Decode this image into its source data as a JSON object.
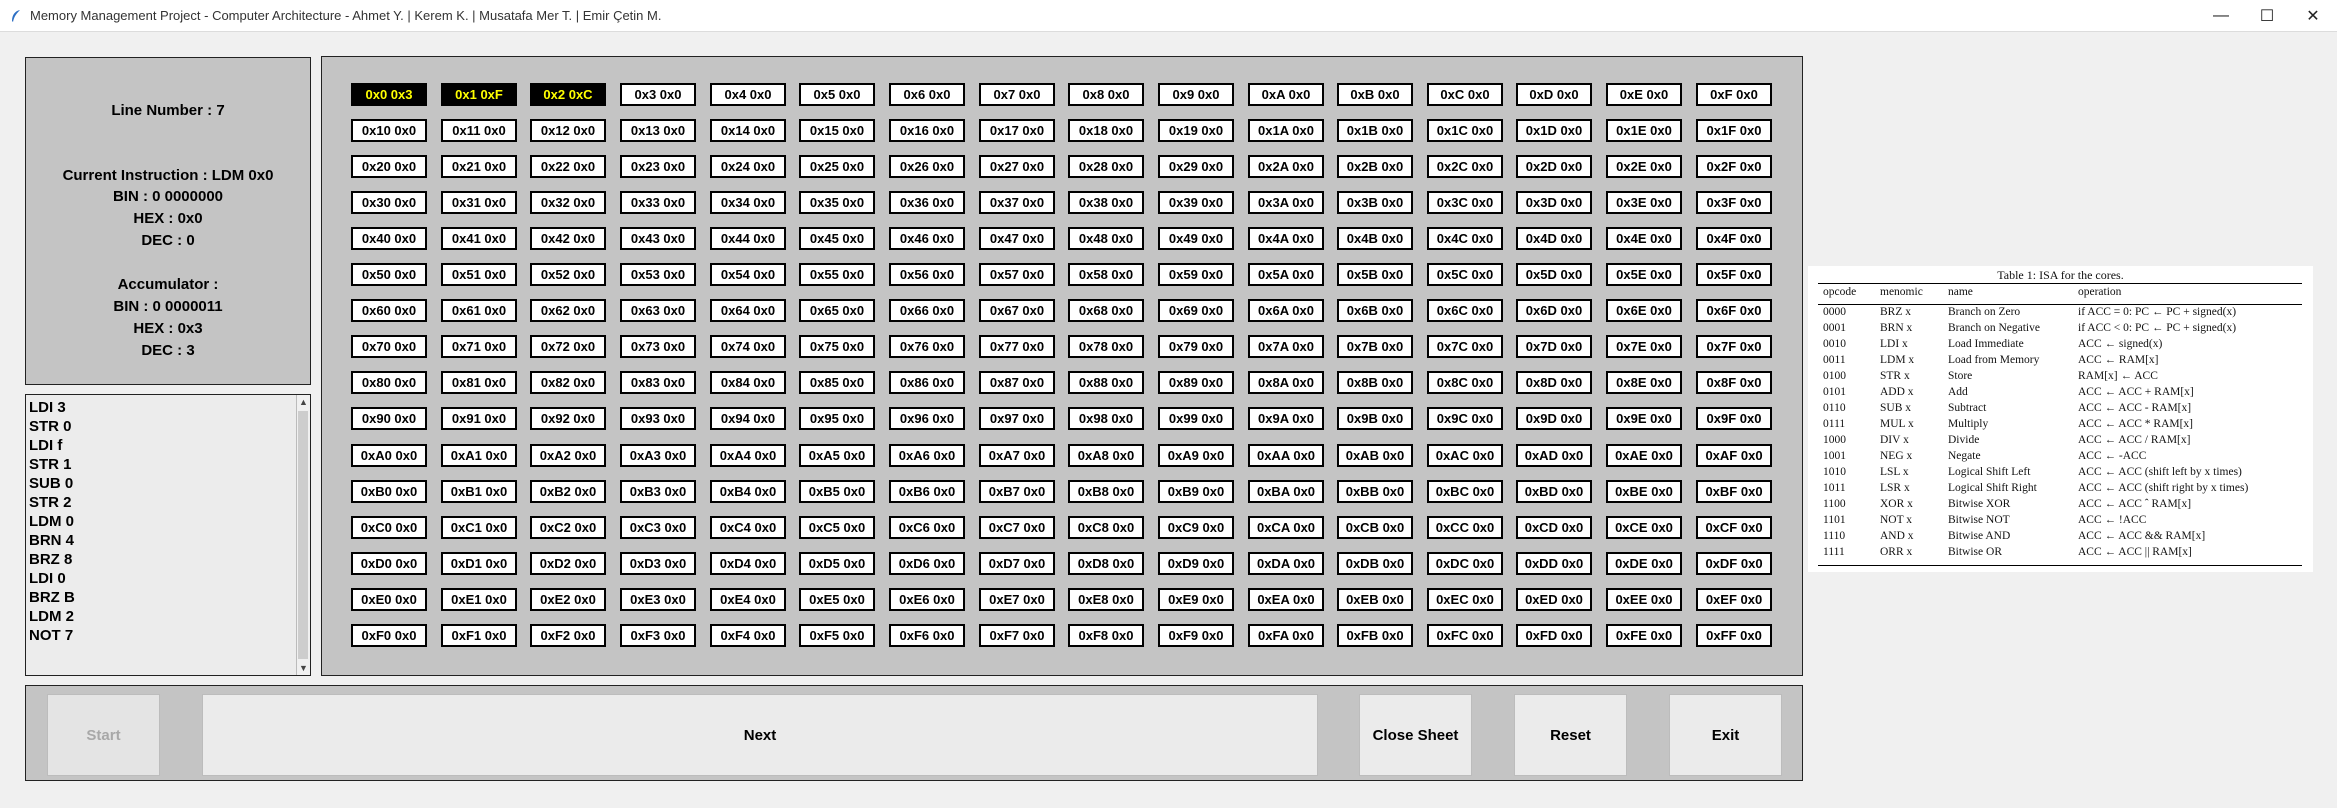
{
  "window": {
    "title": "Memory Management Project - Computer Architecture - Ahmet Y. | Kerem K. | Musatafa Mer T. | Emir Çetin M.",
    "minimize_glyph": "—",
    "maximize_glyph": "☐",
    "close_glyph": "✕"
  },
  "info": {
    "line_number": "Line Number  :  7",
    "current_instruction": "Current Instruction  : LDM 0x0",
    "instr_bin": "BIN  :  0 0000000",
    "instr_hex": "HEX  :   0x0",
    "instr_dec": "DEC  :   0",
    "accumulator": "Accumulator  :",
    "acc_bin": "BIN  :  0 0000011",
    "acc_hex": "HEX  :   0x3",
    "acc_dec": "DEC  :   3"
  },
  "code": [
    "LDI 3",
    "STR 0",
    "LDI f",
    "STR 1",
    "SUB 0",
    "STR 2",
    "LDM 0",
    "BRN 4",
    "BRZ 8",
    "LDI 0",
    "BRZ B",
    "LDM 2",
    "NOT 7"
  ],
  "memory": {
    "highlight_color": "#ffff00",
    "cells": [
      [
        "0x0 0x3",
        "0x1 0xF",
        "0x2 0xC",
        "0x3 0x0",
        "0x4 0x0",
        "0x5 0x0",
        "0x6 0x0",
        "0x7 0x0",
        "0x8 0x0",
        "0x9 0x0",
        "0xA 0x0",
        "0xB 0x0",
        "0xC 0x0",
        "0xD 0x0",
        "0xE 0x0",
        "0xF 0x0"
      ],
      [
        "0x10 0x0",
        "0x11 0x0",
        "0x12 0x0",
        "0x13 0x0",
        "0x14 0x0",
        "0x15 0x0",
        "0x16 0x0",
        "0x17 0x0",
        "0x18 0x0",
        "0x19 0x0",
        "0x1A 0x0",
        "0x1B 0x0",
        "0x1C 0x0",
        "0x1D 0x0",
        "0x1E 0x0",
        "0x1F 0x0"
      ],
      [
        "0x20 0x0",
        "0x21 0x0",
        "0x22 0x0",
        "0x23 0x0",
        "0x24 0x0",
        "0x25 0x0",
        "0x26 0x0",
        "0x27 0x0",
        "0x28 0x0",
        "0x29 0x0",
        "0x2A 0x0",
        "0x2B 0x0",
        "0x2C 0x0",
        "0x2D 0x0",
        "0x2E 0x0",
        "0x2F 0x0"
      ],
      [
        "0x30 0x0",
        "0x31 0x0",
        "0x32 0x0",
        "0x33 0x0",
        "0x34 0x0",
        "0x35 0x0",
        "0x36 0x0",
        "0x37 0x0",
        "0x38 0x0",
        "0x39 0x0",
        "0x3A 0x0",
        "0x3B 0x0",
        "0x3C 0x0",
        "0x3D 0x0",
        "0x3E 0x0",
        "0x3F 0x0"
      ],
      [
        "0x40 0x0",
        "0x41 0x0",
        "0x42 0x0",
        "0x43 0x0",
        "0x44 0x0",
        "0x45 0x0",
        "0x46 0x0",
        "0x47 0x0",
        "0x48 0x0",
        "0x49 0x0",
        "0x4A 0x0",
        "0x4B 0x0",
        "0x4C 0x0",
        "0x4D 0x0",
        "0x4E 0x0",
        "0x4F 0x0"
      ],
      [
        "0x50 0x0",
        "0x51 0x0",
        "0x52 0x0",
        "0x53 0x0",
        "0x54 0x0",
        "0x55 0x0",
        "0x56 0x0",
        "0x57 0x0",
        "0x58 0x0",
        "0x59 0x0",
        "0x5A 0x0",
        "0x5B 0x0",
        "0x5C 0x0",
        "0x5D 0x0",
        "0x5E 0x0",
        "0x5F 0x0"
      ],
      [
        "0x60 0x0",
        "0x61 0x0",
        "0x62 0x0",
        "0x63 0x0",
        "0x64 0x0",
        "0x65 0x0",
        "0x66 0x0",
        "0x67 0x0",
        "0x68 0x0",
        "0x69 0x0",
        "0x6A 0x0",
        "0x6B 0x0",
        "0x6C 0x0",
        "0x6D 0x0",
        "0x6E 0x0",
        "0x6F 0x0"
      ],
      [
        "0x70 0x0",
        "0x71 0x0",
        "0x72 0x0",
        "0x73 0x0",
        "0x74 0x0",
        "0x75 0x0",
        "0x76 0x0",
        "0x77 0x0",
        "0x78 0x0",
        "0x79 0x0",
        "0x7A 0x0",
        "0x7B 0x0",
        "0x7C 0x0",
        "0x7D 0x0",
        "0x7E 0x0",
        "0x7F 0x0"
      ],
      [
        "0x80 0x0",
        "0x81 0x0",
        "0x82 0x0",
        "0x83 0x0",
        "0x84 0x0",
        "0x85 0x0",
        "0x86 0x0",
        "0x87 0x0",
        "0x88 0x0",
        "0x89 0x0",
        "0x8A 0x0",
        "0x8B 0x0",
        "0x8C 0x0",
        "0x8D 0x0",
        "0x8E 0x0",
        "0x8F 0x0"
      ],
      [
        "0x90 0x0",
        "0x91 0x0",
        "0x92 0x0",
        "0x93 0x0",
        "0x94 0x0",
        "0x95 0x0",
        "0x96 0x0",
        "0x97 0x0",
        "0x98 0x0",
        "0x99 0x0",
        "0x9A 0x0",
        "0x9B 0x0",
        "0x9C 0x0",
        "0x9D 0x0",
        "0x9E 0x0",
        "0x9F 0x0"
      ],
      [
        "0xA0 0x0",
        "0xA1 0x0",
        "0xA2 0x0",
        "0xA3 0x0",
        "0xA4 0x0",
        "0xA5 0x0",
        "0xA6 0x0",
        "0xA7 0x0",
        "0xA8 0x0",
        "0xA9 0x0",
        "0xAA 0x0",
        "0xAB 0x0",
        "0xAC 0x0",
        "0xAD 0x0",
        "0xAE 0x0",
        "0xAF 0x0"
      ],
      [
        "0xB0 0x0",
        "0xB1 0x0",
        "0xB2 0x0",
        "0xB3 0x0",
        "0xB4 0x0",
        "0xB5 0x0",
        "0xB6 0x0",
        "0xB7 0x0",
        "0xB8 0x0",
        "0xB9 0x0",
        "0xBA 0x0",
        "0xBB 0x0",
        "0xBC 0x0",
        "0xBD 0x0",
        "0xBE 0x0",
        "0xBF 0x0"
      ],
      [
        "0xC0 0x0",
        "0xC1 0x0",
        "0xC2 0x0",
        "0xC3 0x0",
        "0xC4 0x0",
        "0xC5 0x0",
        "0xC6 0x0",
        "0xC7 0x0",
        "0xC8 0x0",
        "0xC9 0x0",
        "0xCA 0x0",
        "0xCB 0x0",
        "0xCC 0x0",
        "0xCD 0x0",
        "0xCE 0x0",
        "0xCF 0x0"
      ],
      [
        "0xD0 0x0",
        "0xD1 0x0",
        "0xD2 0x0",
        "0xD3 0x0",
        "0xD4 0x0",
        "0xD5 0x0",
        "0xD6 0x0",
        "0xD7 0x0",
        "0xD8 0x0",
        "0xD9 0x0",
        "0xDA 0x0",
        "0xDB 0x0",
        "0xDC 0x0",
        "0xDD 0x0",
        "0xDE 0x0",
        "0xDF 0x0"
      ],
      [
        "0xE0 0x0",
        "0xE1 0x0",
        "0xE2 0x0",
        "0xE3 0x0",
        "0xE4 0x0",
        "0xE5 0x0",
        "0xE6 0x0",
        "0xE7 0x0",
        "0xE8 0x0",
        "0xE9 0x0",
        "0xEA 0x0",
        "0xEB 0x0",
        "0xEC 0x0",
        "0xED 0x0",
        "0xEE 0x0",
        "0xEF 0x0"
      ],
      [
        "0xF0 0x0",
        "0xF1 0x0",
        "0xF2 0x0",
        "0xF3 0x0",
        "0xF4 0x0",
        "0xF5 0x0",
        "0xF6 0x0",
        "0xF7 0x0",
        "0xF8 0x0",
        "0xF9 0x0",
        "0xFA 0x0",
        "0xFB 0x0",
        "0xFC 0x0",
        "0xFD 0x0",
        "0xFE 0x0",
        "0xFF 0x0"
      ]
    ],
    "highlighted": [
      "0x0 0x3",
      "0x1 0xF",
      "0x2 0xC"
    ]
  },
  "buttons": {
    "start": "Start",
    "next": "Next",
    "close_sheet": "Close Sheet",
    "reset": "Reset",
    "exit": "Exit"
  },
  "isa_table": {
    "caption": "Table 1: ISA for the cores.",
    "headers": [
      "opcode",
      "menomic",
      "name",
      "operation"
    ],
    "rows": [
      [
        "0000",
        "BRZ x",
        "Branch on Zero",
        "if ACC = 0: PC ← PC + signed(x)"
      ],
      [
        "0001",
        "BRN x",
        "Branch on Negative",
        "if ACC < 0: PC ← PC + signed(x)"
      ],
      [
        "0010",
        "LDI x",
        "Load Immediate",
        "ACC ← signed(x)"
      ],
      [
        "0011",
        "LDM x",
        "Load from Memory",
        "ACC ← RAM[x]"
      ],
      [
        "0100",
        "STR x",
        "Store",
        "RAM[x] ← ACC"
      ],
      [
        "0101",
        "ADD x",
        "Add",
        "ACC ← ACC + RAM[x]"
      ],
      [
        "0110",
        "SUB x",
        "Subtract",
        "ACC ← ACC - RAM[x]"
      ],
      [
        "0111",
        "MUL x",
        "Multiply",
        "ACC ← ACC * RAM[x]"
      ],
      [
        "1000",
        "DIV x",
        "Divide",
        "ACC ← ACC / RAM[x]"
      ],
      [
        "1001",
        "NEG x",
        "Negate",
        "ACC ← -ACC"
      ],
      [
        "1010",
        "LSL x",
        "Logical Shift Left",
        "ACC ← ACC (shift left by x times)"
      ],
      [
        "1011",
        "LSR x",
        "Logical Shift Right",
        "ACC ← ACC (shift right by x times)"
      ],
      [
        "1100",
        "XOR x",
        "Bitwise XOR",
        "ACC ← ACC ˆ RAM[x]"
      ],
      [
        "1101",
        "NOT x",
        "Bitwise NOT",
        "ACC ← !ACC"
      ],
      [
        "1110",
        "AND x",
        "Bitwise AND",
        "ACC ← ACC && RAM[x]"
      ],
      [
        "1111",
        "ORR x",
        "Bitwise OR",
        "ACC ← ACC || RAM[x]"
      ]
    ]
  }
}
